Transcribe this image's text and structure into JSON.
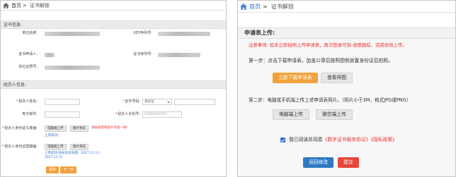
{
  "left": {
    "breadcrumb": {
      "home": "首页",
      "separator": ">",
      "current": "证书解锁"
    },
    "cert_section": {
      "title": "证书信息:",
      "fields": [
        {
          "label": "单位名称:"
        },
        {
          "label": "KEY序列号:"
        },
        {
          "label": "证书申请人:"
        },
        {
          "label": "证书序列号:"
        },
        {
          "label": "单位证照号:"
        }
      ]
    },
    "agent_section": {
      "title": "经办人信息:",
      "name_label": "经办人姓名:",
      "id_type_label": "证件号码:",
      "id_type_value": "身份证",
      "email_label": "电子邮件:",
      "phone_label": "经办人手机号:",
      "phone_value": "13056259747",
      "front_label": "经办人身份证头像面:",
      "back_label": "经办人身份证国徽面:",
      "upload_button": "电脑端上传",
      "preview_button": "图片预览",
      "front_hint": "请按清楚和图片内容一致!",
      "front_success": "上传成功!",
      "back_success": "上传成功!身份证有效期：2017.11.11 - 2037.11.11",
      "prev_button": "保存",
      "next_button": "下一步"
    }
  },
  "right": {
    "breadcrumb": {
      "home": "首页",
      "separator": ">",
      "current": "证书解锁"
    },
    "section_title": "申请表上传:",
    "notice": "注意事项: 如未立即拍照上传申请表，再次登录可到-进度跟踪，完成修改上传。",
    "step1": "第一步：点击下载申请表，加盖公章后按照图例放置身份证后拍照。",
    "download_button": "立即下载申请表",
    "example_button": "查看样图",
    "step2": "第二步：电脑或手机端上传上述申请表照片。（照片小于3M，格式JPG或PNG）",
    "pc_upload_button": "电脑端上传",
    "wechat_upload_button": "微信端上传",
    "agreement_prefix": "我已阅读并同意",
    "agreement_link1": "《数字证书服务协议》",
    "agreement_link2": "《隐私政策》",
    "back_button": "返回修改",
    "submit_button": "提交"
  }
}
